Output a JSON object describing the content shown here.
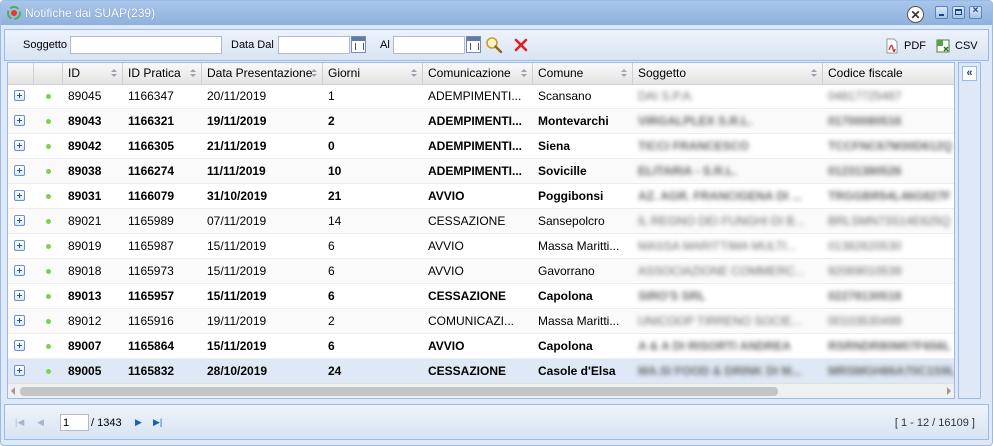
{
  "window": {
    "title": "Notifiche dai SUAP(239)"
  },
  "toolbar": {
    "soggetto_label": "Soggetto",
    "soggetto_value": "",
    "data_dal_label": "Data Dal",
    "data_dal_value": "",
    "al_label": "Al",
    "al_value": "",
    "pdf_label": "PDF",
    "csv_label": "CSV"
  },
  "columns": [
    "ID",
    "ID Pratica",
    "Data Presentazione",
    "Giorni",
    "Comunicazione",
    "Comune",
    "Soggetto",
    "Codice fiscale"
  ],
  "rows": [
    {
      "id": "89045",
      "pratica": "1166347",
      "data": "20/11/2019",
      "giorni": "1",
      "comunicazione": "ADEMPIMENTI...",
      "comune": "Scansano",
      "soggetto": "DAI S.P.A.",
      "cf": "04817725467"
    },
    {
      "id": "89043",
      "pratica": "1166321",
      "data": "19/11/2019",
      "giorni": "2",
      "comunicazione": "ADEMPIMENTI...",
      "comune": "Montevarchi",
      "soggetto": "VIRGALPLEX S.R.L.",
      "cf": "01700080516"
    },
    {
      "id": "89042",
      "pratica": "1166305",
      "data": "21/11/2019",
      "giorni": "0",
      "comunicazione": "ADEMPIMENTI...",
      "comune": "Siena",
      "soggetto": "TICCI FRANCESCO",
      "cf": "TCCFNC67M30D612Q"
    },
    {
      "id": "89038",
      "pratica": "1166274",
      "data": "11/11/2019",
      "giorni": "10",
      "comunicazione": "ADEMPIMENTI...",
      "comune": "Sovicille",
      "soggetto": "ELITARIA - S.R.L.",
      "cf": "01231380526"
    },
    {
      "id": "89031",
      "pratica": "1166079",
      "data": "31/10/2019",
      "giorni": "21",
      "comunicazione": "AVVIO",
      "comune": "Poggibonsi",
      "soggetto": "AZ. AGR. FRANCIGENA DI ...",
      "cf": "TRGGBR54L46G827F"
    },
    {
      "id": "89021",
      "pratica": "1165989",
      "data": "07/11/2019",
      "giorni": "14",
      "comunicazione": "CESSAZIONE",
      "comune": "Sansepolcro",
      "soggetto": "IL REGNO DEI FUNGHI DI B...",
      "cf": "BRLSMN73S14E625Q"
    },
    {
      "id": "89019",
      "pratica": "1165987",
      "data": "15/11/2019",
      "giorni": "6",
      "comunicazione": "AVVIO",
      "comune": "Massa Maritti...",
      "soggetto": "MASSA MARITTIMA MULTI...",
      "cf": "01382620530"
    },
    {
      "id": "89018",
      "pratica": "1165973",
      "data": "15/11/2019",
      "giorni": "6",
      "comunicazione": "AVVIO",
      "comune": "Gavorrano",
      "soggetto": "ASSOCIAZIONE COMMERC...",
      "cf": "92069010539"
    },
    {
      "id": "89013",
      "pratica": "1165957",
      "data": "15/11/2019",
      "giorni": "6",
      "comunicazione": "CESSAZIONE",
      "comune": "Capolona",
      "soggetto": "SIRO'S SRL",
      "cf": "02278130518"
    },
    {
      "id": "89012",
      "pratica": "1165916",
      "data": "19/11/2019",
      "giorni": "2",
      "comunicazione": "COMUNICAZI...",
      "comune": "Massa Maritti...",
      "soggetto": "UNICOOP TIRRENO SOCIE...",
      "cf": "00103530499"
    },
    {
      "id": "89007",
      "pratica": "1165864",
      "data": "15/11/2019",
      "giorni": "6",
      "comunicazione": "AVVIO",
      "comune": "Capolona",
      "soggetto": "A & A DI RISORTI ANDREA",
      "cf": "RSRNDR80M07F656L"
    },
    {
      "id": "89005",
      "pratica": "1165832",
      "data": "28/10/2019",
      "giorni": "24",
      "comunicazione": "CESSAZIONE",
      "comune": "Casole d'Elsa",
      "soggetto": "MA.SI FOOD & DRINK DI M...",
      "cf": "MRSMGH86A70C1S9L"
    }
  ],
  "pager": {
    "page_value": "1",
    "total_pages": "/ 1343",
    "info": "[ 1 - 12 / 16109 ]"
  },
  "colors": {
    "accent": "#99bbe8",
    "status_dot": "#7bd34a",
    "delete": "#e02020"
  }
}
